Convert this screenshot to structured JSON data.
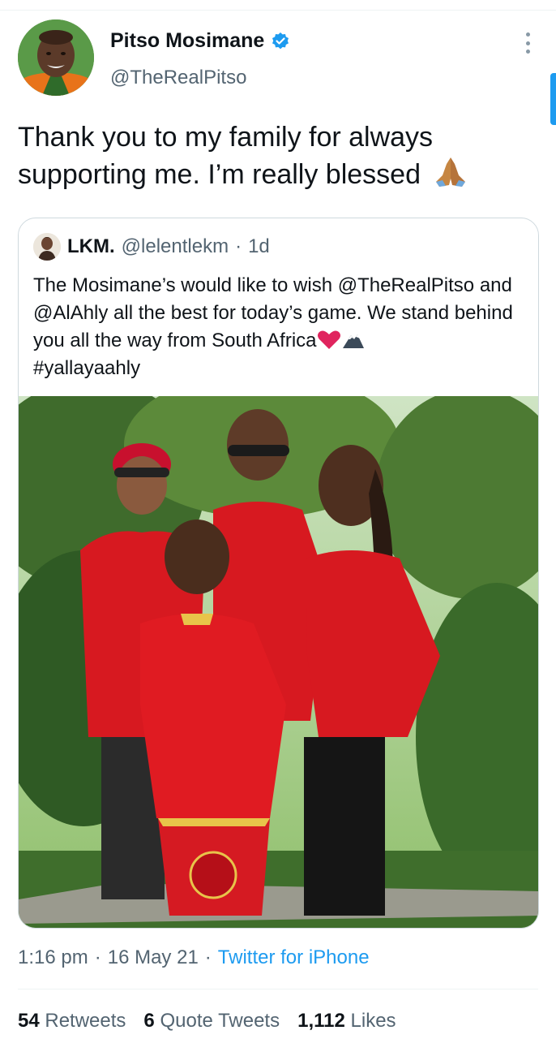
{
  "author": {
    "name": "Pitso Mosimane",
    "handle": "@TheRealPitso",
    "verified": true,
    "avatar_icon": "profile-photo"
  },
  "tweet": {
    "text": "Thank you to my family for always supporting me. I’m really blessed",
    "emoji": "folded-hands"
  },
  "quoted_tweet": {
    "name": "LKM.",
    "handle": "@lelentlekm",
    "separator": "·",
    "time": "1d",
    "text": "The Mosimane’s would like to wish @TheRealPitso and @AlAhly all the best for today’s game. We stand behind you all the way from South Africa",
    "hashtag": "#yallayaahly",
    "emojis": [
      "red-heart",
      "snow-capped-mountain"
    ],
    "photo_icon": "family-photo"
  },
  "meta": {
    "time": "1:16 pm",
    "separator": "·",
    "date": "16 May 21",
    "separator2": "·",
    "source": "Twitter for iPhone"
  },
  "stats": {
    "retweets_count": "54",
    "retweets_label": "Retweets",
    "quotes_count": "6",
    "quotes_label": "Quote Tweets",
    "likes_count": "1,112",
    "likes_label": "Likes"
  },
  "colors": {
    "accent": "#1d9bf0",
    "text_primary": "#0f1419",
    "text_secondary": "#536471",
    "border": "#cfd9de"
  }
}
